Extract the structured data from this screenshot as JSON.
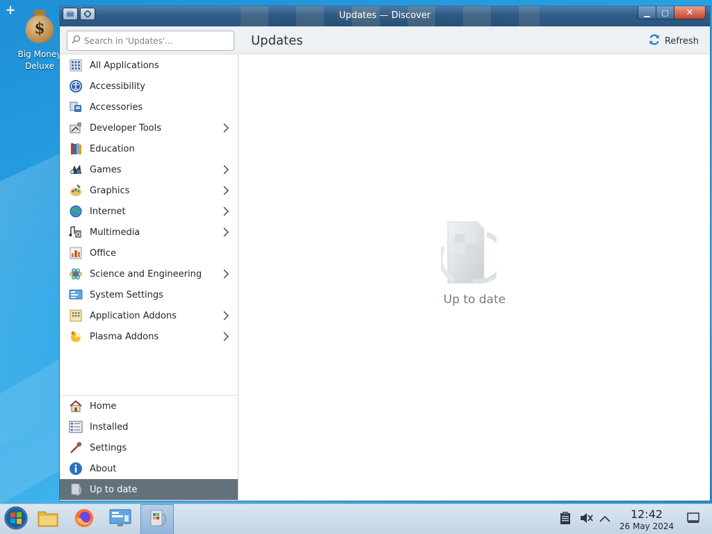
{
  "desktop": {
    "icon_label": "Big Money Deluxe"
  },
  "window": {
    "title": "Updates — Discover",
    "controls": {
      "minimize": "▁",
      "maximize": "▢",
      "close": "✕"
    }
  },
  "header": {
    "search_placeholder": "Search in 'Updates'...",
    "page_title": "Updates",
    "refresh_label": "Refresh"
  },
  "sidebar": {
    "categories": [
      {
        "label": "All Applications",
        "icon": "grid-icon",
        "submenu": false
      },
      {
        "label": "Accessibility",
        "icon": "accessibility-icon",
        "submenu": false
      },
      {
        "label": "Accessories",
        "icon": "accessories-icon",
        "submenu": false
      },
      {
        "label": "Developer Tools",
        "icon": "developer-tools-icon",
        "submenu": true
      },
      {
        "label": "Education",
        "icon": "education-icon",
        "submenu": false
      },
      {
        "label": "Games",
        "icon": "games-icon",
        "submenu": true
      },
      {
        "label": "Graphics",
        "icon": "graphics-icon",
        "submenu": true
      },
      {
        "label": "Internet",
        "icon": "internet-icon",
        "submenu": true
      },
      {
        "label": "Multimedia",
        "icon": "multimedia-icon",
        "submenu": true
      },
      {
        "label": "Office",
        "icon": "office-icon",
        "submenu": false
      },
      {
        "label": "Science and Engineering",
        "icon": "science-icon",
        "submenu": true
      },
      {
        "label": "System Settings",
        "icon": "system-settings-icon",
        "submenu": false
      },
      {
        "label": "Application Addons",
        "icon": "application-addons-icon",
        "submenu": true
      },
      {
        "label": "Plasma Addons",
        "icon": "plasma-addons-icon",
        "submenu": true
      }
    ],
    "bottom": [
      {
        "label": "Home",
        "icon": "home-icon"
      },
      {
        "label": "Installed",
        "icon": "installed-icon"
      },
      {
        "label": "Settings",
        "icon": "settings-icon"
      },
      {
        "label": "About",
        "icon": "about-icon"
      },
      {
        "label": "Up to date",
        "icon": "update-status-icon",
        "active": true
      }
    ]
  },
  "main": {
    "status_text": "Up to date"
  },
  "taskbar": {
    "clock_time": "12:42",
    "clock_date": "26 May 2024"
  },
  "colors": {
    "active_nav_bg": "#63717b",
    "titlebar": "#2e5c8a",
    "close_button": "#c7432a"
  }
}
